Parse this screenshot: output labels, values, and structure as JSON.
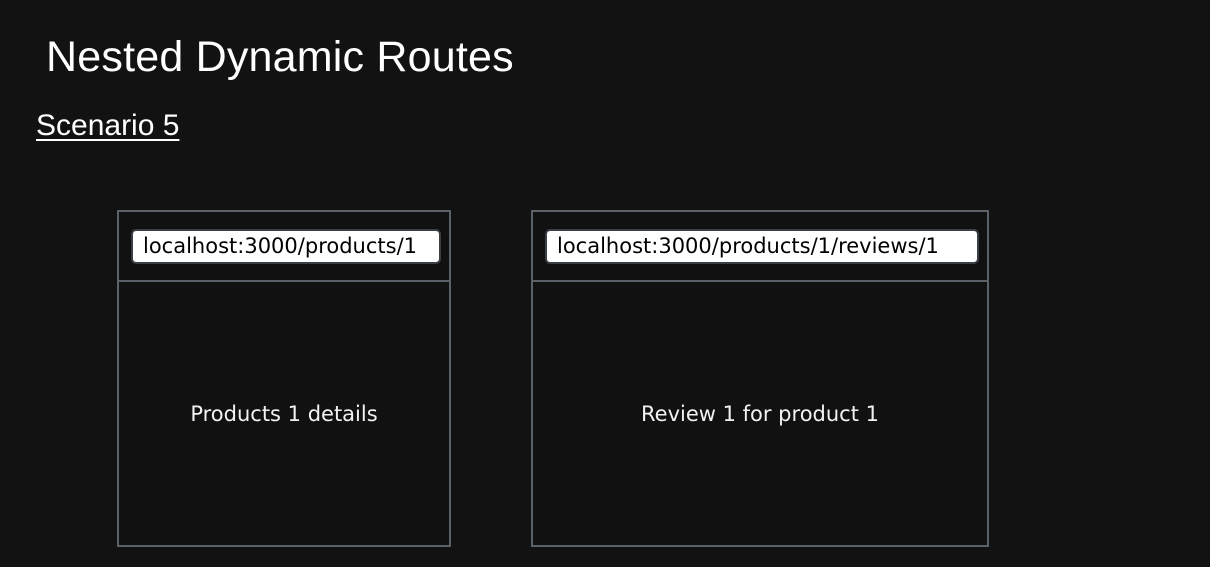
{
  "slide": {
    "title": "Nested Dynamic Routes",
    "scenario": "Scenario 5"
  },
  "browsers": [
    {
      "url": "localhost:3000/products/1",
      "content": "Products 1 details"
    },
    {
      "url": "localhost:3000/products/1/reviews/1",
      "content": "Review 1 for product 1"
    }
  ],
  "colors": {
    "background": "#121212",
    "frame_border": "#5b6168",
    "text": "#ffffff",
    "address_bar": "#ffffff"
  }
}
